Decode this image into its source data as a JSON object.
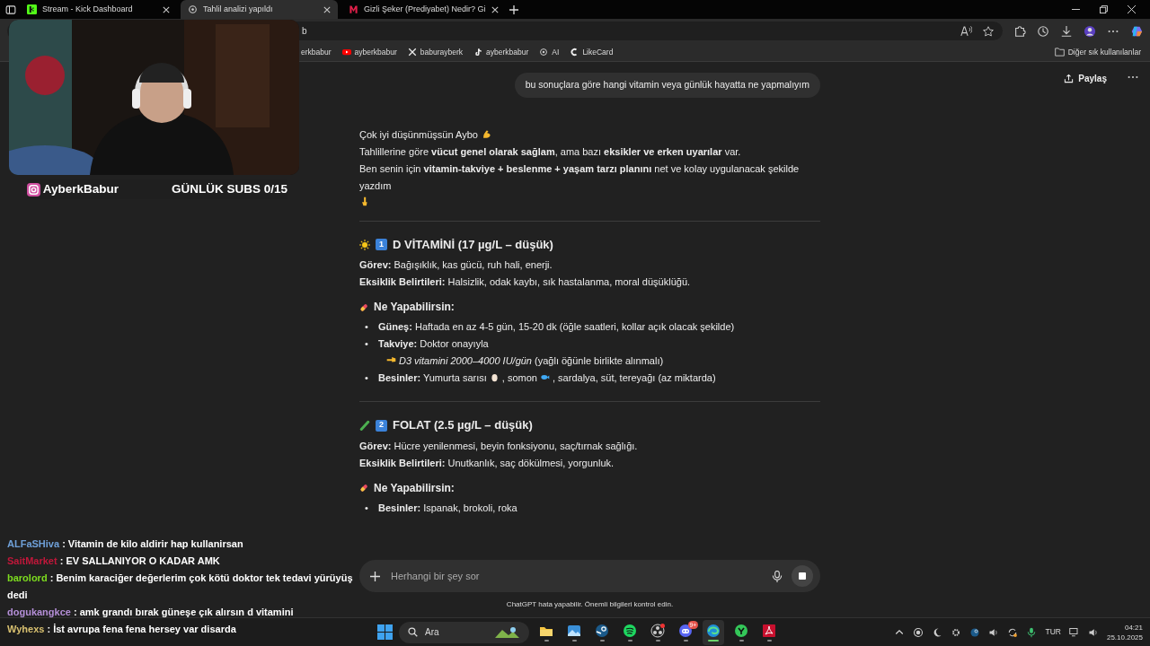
{
  "browser": {
    "tabs": [
      {
        "label": "Stream - Kick Dashboard",
        "selected": false
      },
      {
        "label": "Tahlil analizi yapıldı",
        "selected": true
      },
      {
        "label": "Gizli Şeker (Prediyabet) Nedir? Gi",
        "selected": false
      }
    ],
    "address": "b",
    "bookmarks": [
      "erkbabur",
      "ayberkbabur",
      "baburayberk",
      "ayberkbabur",
      "AI",
      "LikeCard"
    ],
    "other_bookmarks": "Diğer sık kullanılanlar"
  },
  "chat": {
    "share": "Paylaş",
    "user_message": "bu sonuçlara göre hangi vitamin veya günlük hayatta ne yapmalıyım",
    "intro": [
      {
        "kind": "arm",
        "text": "Çok iyi düşünmüşsün Aybo"
      },
      {
        "kind": "plain",
        "text": "Tahlillerine göre **vücut genel olarak sağlam**, ama bazı **eksikler ve erken uyarılar** var."
      },
      {
        "kind": "hand",
        "text": "Ben senin için **vitamin-takviye + beslenme + yaşam tarzı planını** net ve kolay uygulanacak şekilde yazdım"
      }
    ],
    "sections": [
      {
        "kind": "sun",
        "number": "1",
        "title": "D VİTAMİNİ (17 µg/L – düşük)",
        "lines": [
          "**Görev:** Bağışıklık, kas gücü, ruh hali, enerji.",
          "**Eksiklik Belirtileri:** Halsizlik, odak kaybı, sık hastalanma, moral düşüklüğü."
        ],
        "subheading": "Ne Yapabilirsin:",
        "bullets": [
          {
            "marker": "•",
            "parts": [
              {
                "kind": "text",
                "text": "**Güneş:** Haftada en az 4-5 gün, 15-20 dk (öğle saatleri, kollar açık olacak şekilde)"
              }
            ]
          },
          {
            "marker": "•",
            "parts": [
              {
                "kind": "text",
                "text": "**Takviye:** Doktor onayıyla"
              }
            ],
            "children": [
              {
                "parts": [
                  {
                    "kind": "hand"
                  },
                  {
                    "kind": "text",
                    "text": "*D3 vitamini 2000–4000 IU/gün* (yağlı öğünle birlikte alınmalı)"
                  }
                ]
              }
            ]
          },
          {
            "marker": "•",
            "parts": [
              {
                "kind": "text",
                "text": "**Besinler:** Yumurta sarısı"
              },
              {
                "kind": "egg"
              },
              {
                "kind": "text",
                "text": ", somon"
              },
              {
                "kind": "fish"
              },
              {
                "kind": "text",
                "text": ", sardalya, süt, tereyağı (az miktarda)"
              }
            ]
          }
        ]
      },
      {
        "kind": "cucumber",
        "number": "2",
        "title": "FOLAT (2.5 µg/L – düşük)",
        "lines": [
          "**Görev:** Hücre yenilenmesi, beyin fonksiyonu, saç/tırnak sağlığı.",
          "**Eksiklik Belirtileri:** Unutkanlık, saç dökülmesi, yorgunluk."
        ],
        "subheading": "Ne Yapabilirsin:",
        "bullets": [
          {
            "marker": "•",
            "parts": [
              {
                "kind": "text",
                "text": "**Besinler:** Ispanak, brokoli, roka"
              }
            ]
          }
        ]
      }
    ],
    "composer": {
      "placeholder": "Herhangi bir şey sor"
    },
    "disclaimer": "ChatGPT hata yapabilir. Önemli bilgileri kontrol edin."
  },
  "stream": {
    "instagram": "AyberkBabur",
    "subs": "GÜNLÜK SUBS 0/15",
    "messages": [
      {
        "user": "ALFaSHiva",
        "color": "#6fa0d8",
        "text": ": Vitamin de kilo aldirir hap kullanirsan"
      },
      {
        "user": "SaitMarket",
        "color": "#c0173a",
        "text": ": EV SALLANIYOR O KADAR AMK"
      },
      {
        "user": "barolord",
        "color": "#7ddc1f",
        "text": ": Benim karaciğer değerlerim çok kötü doktor tek tedavi yürüyüş dedi"
      },
      {
        "user": "dogukangkce",
        "color": "#b58fd8",
        "text": ": amk grandı bırak güneşe çık alırsın d vitamini"
      },
      {
        "user": "Wyhexs",
        "color": "#d8c070",
        "text": ": İst avrupa fena fena hersey var disarda"
      }
    ]
  },
  "taskbar": {
    "search": "Ara",
    "apps": [
      {
        "kind": "folder",
        "active": false
      },
      {
        "kind": "photos",
        "active": false
      },
      {
        "kind": "steam",
        "active": false
      },
      {
        "kind": "spotify",
        "active": false
      },
      {
        "kind": "obs",
        "active": false
      },
      {
        "kind": "discord",
        "active": false,
        "badge": "9+"
      },
      {
        "kind": "edge",
        "active": true
      },
      {
        "kind": "green",
        "active": false
      },
      {
        "kind": "pdf",
        "active": false
      }
    ],
    "language": "TUR",
    "time": "04:21",
    "date": "25.10.2025"
  }
}
